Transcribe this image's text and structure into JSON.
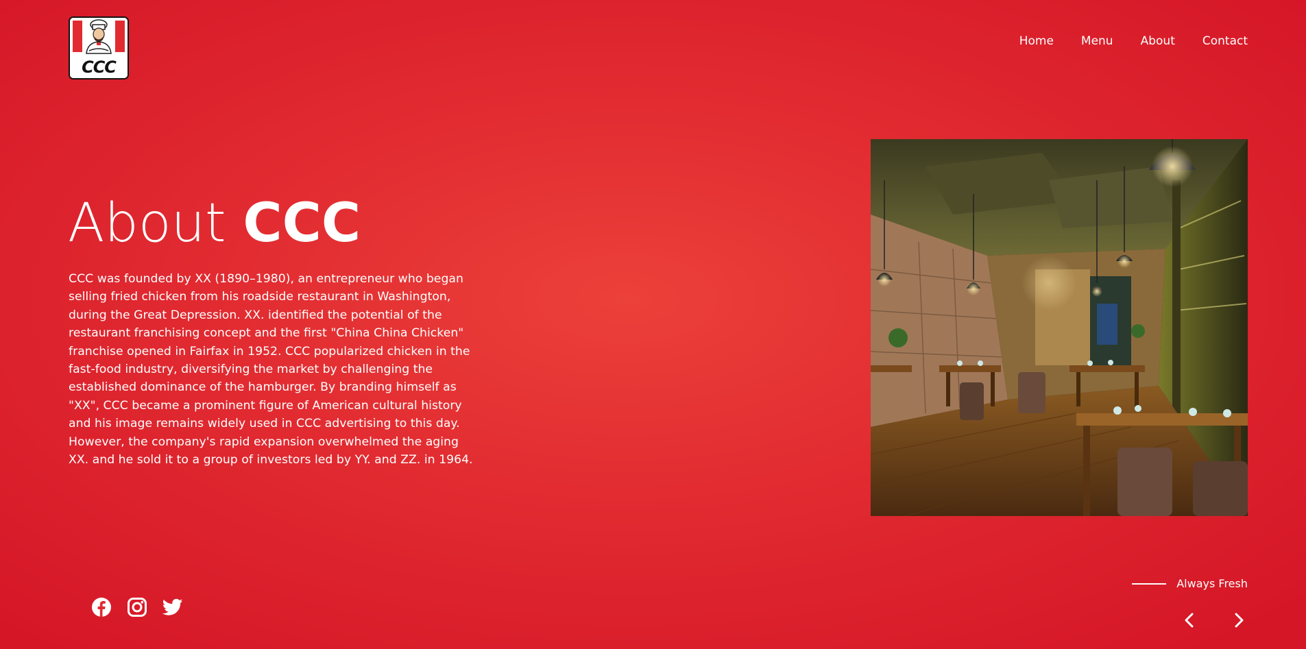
{
  "brand": {
    "logo_text": "CCC",
    "logo_icon": "chef-mascot-icon"
  },
  "nav": {
    "items": [
      "Home",
      "Menu",
      "About",
      "Contact"
    ]
  },
  "hero": {
    "title_light": "About",
    "title_bold": "CCC",
    "body": "CCC was founded by XX (1890–1980), an entrepreneur who began selling fried chicken from his roadside restaurant in Washington, during the Great Depression. XX. identified the potential of the restaurant franchising concept and the first \"China China Chicken\" franchise opened in Fairfax in 1952. CCC popularized chicken in the fast-food industry, diversifying the market by challenging the established dominance of the hamburger. By branding himself as \"XX\", CCC became a prominent figure of American cultural history and his image remains widely used in CCC advertising to this day. However, the company's rapid expansion overwhelmed the aging XX. and he sold it to a group of investors led by YY. and ZZ. in 1964."
  },
  "tagline": "Always Fresh",
  "social": [
    "facebook-icon",
    "instagram-icon",
    "twitter-icon"
  ],
  "carousel": {
    "prev_icon": "chevron-left-icon",
    "next_icon": "chevron-right-icon"
  },
  "colors": {
    "brand_red": "#e12b31",
    "text": "#ffffff"
  }
}
